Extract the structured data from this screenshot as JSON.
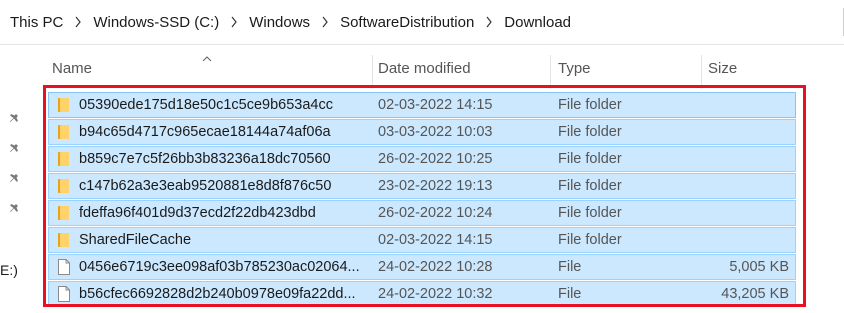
{
  "breadcrumb": [
    "This PC",
    "Windows-SSD (C:)",
    "Windows",
    "SoftwareDistribution",
    "Download"
  ],
  "nav": {
    "drive_fragment": "E:)"
  },
  "columns": {
    "name": "Name",
    "date": "Date modified",
    "type": "Type",
    "size": "Size",
    "sorted_by": "Name"
  },
  "rows": [
    {
      "icon": "folder-icon",
      "name": "05390ede175d18e50c1c5ce9b653a4cc",
      "date": "02-03-2022 14:15",
      "type": "File folder",
      "size": ""
    },
    {
      "icon": "folder-icon",
      "name": "b94c65d4717c965ecae18144a74af06a",
      "date": "03-03-2022 10:03",
      "type": "File folder",
      "size": ""
    },
    {
      "icon": "folder-icon",
      "name": "b859c7e7c5f26bb3b83236a18dc70560",
      "date": "26-02-2022 10:25",
      "type": "File folder",
      "size": ""
    },
    {
      "icon": "folder-icon",
      "name": "c147b62a3e3eab9520881e8d8f876c50",
      "date": "23-02-2022 19:13",
      "type": "File folder",
      "size": ""
    },
    {
      "icon": "folder-icon",
      "name": "fdeffa96f401d9d37ecd2f22db423dbd",
      "date": "26-02-2022 10:24",
      "type": "File folder",
      "size": ""
    },
    {
      "icon": "folder-icon",
      "name": "SharedFileCache",
      "date": "02-03-2022 14:15",
      "type": "File folder",
      "size": ""
    },
    {
      "icon": "file-icon",
      "name": "0456e6719c3ee098af03b785230ac02064...",
      "date": "24-02-2022 10:28",
      "type": "File",
      "size": "5,005 KB"
    },
    {
      "icon": "file-icon",
      "name": "b56cfec6692828d2b240b0978e09fa22dd...",
      "date": "24-02-2022 10:32",
      "type": "File",
      "size": "43,205 KB"
    }
  ],
  "colors": {
    "selection": "#cce8ff",
    "selection_border": "#99d1ff",
    "highlight_outline": "#e81123"
  }
}
